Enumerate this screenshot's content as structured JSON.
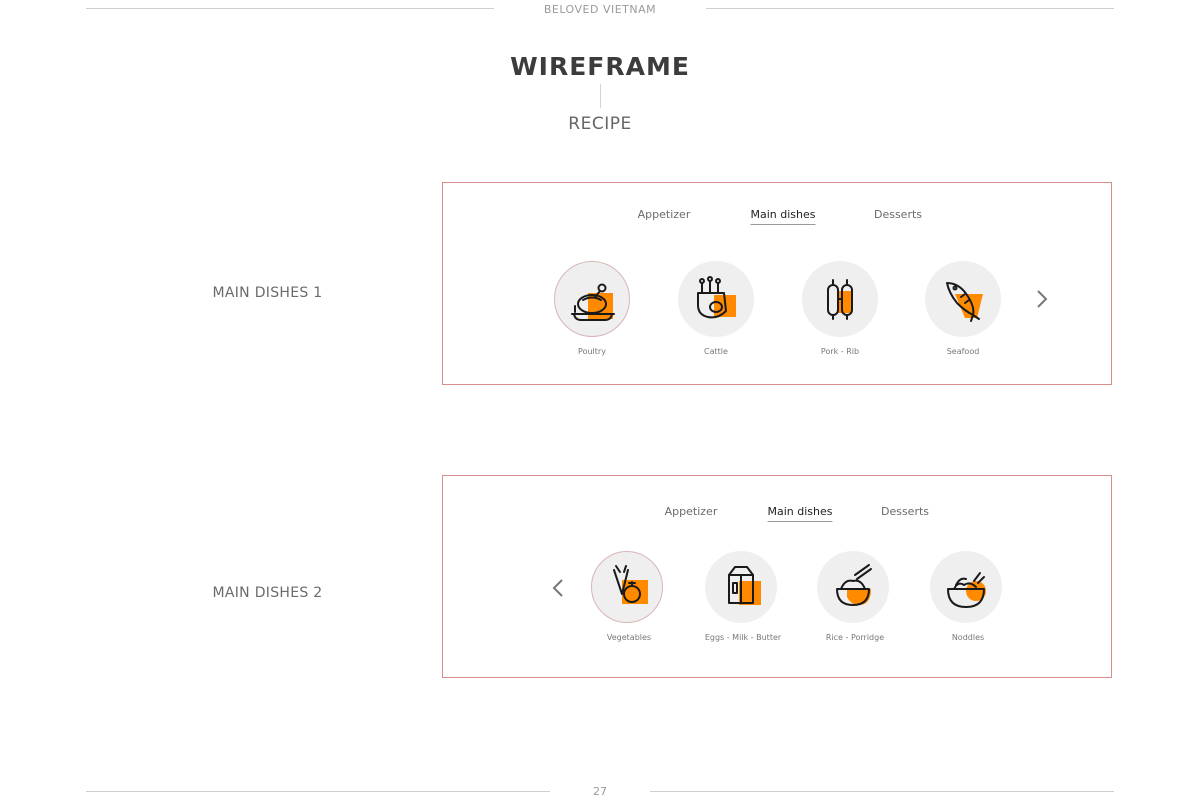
{
  "header": {
    "running_title": "BELOVED VIETNAM",
    "page_number": "27"
  },
  "page": {
    "title": "WIREFRAME",
    "subtitle": "RECIPE"
  },
  "colors": {
    "accent": "#ff8a00",
    "frame_border": "#d98e8e",
    "icon_bg": "#efefef",
    "rule": "#cfcfcf"
  },
  "sections": [
    {
      "label": "MAIN DISHES 1",
      "tabs": [
        {
          "label": "Appetizer",
          "active": false
        },
        {
          "label": "Main dishes",
          "active": true
        },
        {
          "label": "Desserts",
          "active": false
        }
      ],
      "categories": [
        {
          "label": "Poultry",
          "icon": "roast-chicken-icon",
          "selected": true
        },
        {
          "label": "Cattle",
          "icon": "beef-ribs-icon",
          "selected": false
        },
        {
          "label": "Pork - Rib",
          "icon": "pork-sausage-icon",
          "selected": false
        },
        {
          "label": "Seafood",
          "icon": "fish-icon",
          "selected": false
        }
      ],
      "nav_icon": "chevron-right-icon"
    },
    {
      "label": "MAIN DISHES 2",
      "tabs": [
        {
          "label": "Appetizer",
          "active": false
        },
        {
          "label": "Main dishes",
          "active": true
        },
        {
          "label": "Desserts",
          "active": false
        }
      ],
      "categories": [
        {
          "label": "Vegetables",
          "icon": "vegetables-icon",
          "selected": true
        },
        {
          "label": "Eggs - Milk - Butter",
          "icon": "milk-carton-icon",
          "selected": false
        },
        {
          "label": "Rice - Porridge",
          "icon": "rice-bowl-icon",
          "selected": false
        },
        {
          "label": "Noddles",
          "icon": "noodle-bowl-icon",
          "selected": false
        }
      ],
      "nav_icon": "chevron-left-icon"
    }
  ]
}
